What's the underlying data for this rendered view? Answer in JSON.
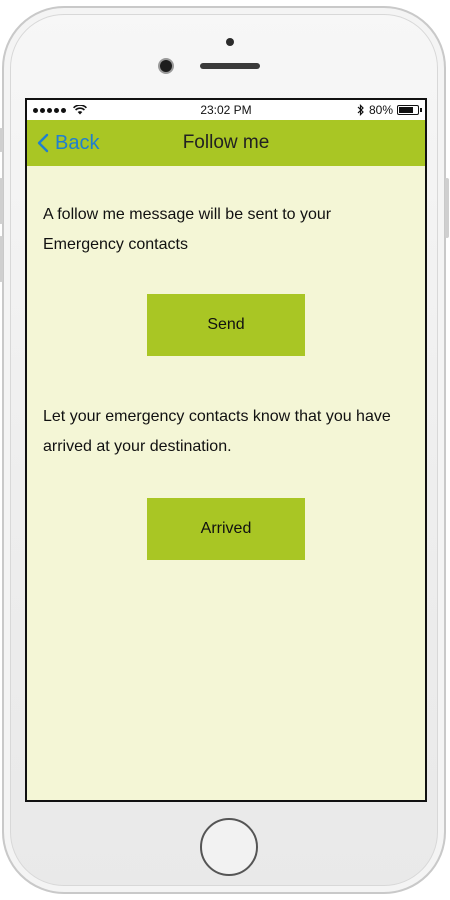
{
  "status_bar": {
    "time": "23:02 PM",
    "battery_text": "80%",
    "battery_level": 0.8
  },
  "nav": {
    "back_label": "Back",
    "title": "Follow me"
  },
  "main": {
    "follow_message": "A follow me message will be sent to your Emergency contacts",
    "send_label": "Send",
    "arrived_message": "Let your emergency contacts know that you have arrived at your destination.",
    "arrived_label": "Arrived"
  },
  "colors": {
    "accent": "#a9c624",
    "background": "#f4f6d6",
    "link": "#1f7fd0"
  },
  "icons": [
    "signal-dots-icon",
    "wifi-icon",
    "bluetooth-icon",
    "battery-icon",
    "chevron-left-icon"
  ]
}
